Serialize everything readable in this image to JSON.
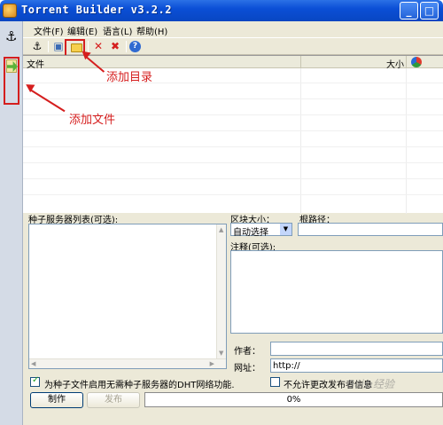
{
  "window": {
    "title": "Torrent Builder v3.2.2",
    "min_label": "_",
    "max_label": "□"
  },
  "menu": {
    "items": [
      "文件(F)",
      "编辑(E)",
      "语言(L)",
      "帮助(H)"
    ]
  },
  "toolbar": {
    "icons": [
      "anchor-icon",
      "window-icon",
      "folder-icon",
      "delete-icon",
      "delete-all-icon",
      "help-icon"
    ],
    "anchor_glyph": "⚓",
    "window_glyph": "▣",
    "delete_glyph": "✕",
    "delete_all_glyph": "✖",
    "help_glyph": "?"
  },
  "sidebar": {
    "anchor_glyph": "⚓"
  },
  "filelist": {
    "columns": [
      "文件",
      "大小"
    ]
  },
  "trackers": {
    "label": "种子服务器列表(可选):"
  },
  "piece": {
    "label": "区块大小：",
    "value": "自动选择",
    "arrow": "▼"
  },
  "root": {
    "label": "根路径："
  },
  "comment": {
    "label": "注释(可选):"
  },
  "author": {
    "label": "作者："
  },
  "url": {
    "label": "网址：",
    "value": "http://"
  },
  "options": {
    "dht_label": "为种子文件启用无需种子服务器的DHT网络功能.",
    "dht_checked": true,
    "lock_label": "不允许更改发布者信息",
    "lock_checked": false
  },
  "buttons": {
    "make": "制作",
    "publish": "发布"
  },
  "progress": {
    "text": "0%",
    "value": 0
  },
  "annotations": {
    "add_dir": "添加目录",
    "add_file": "添加文件"
  },
  "watermark": "Bai✿经验"
}
